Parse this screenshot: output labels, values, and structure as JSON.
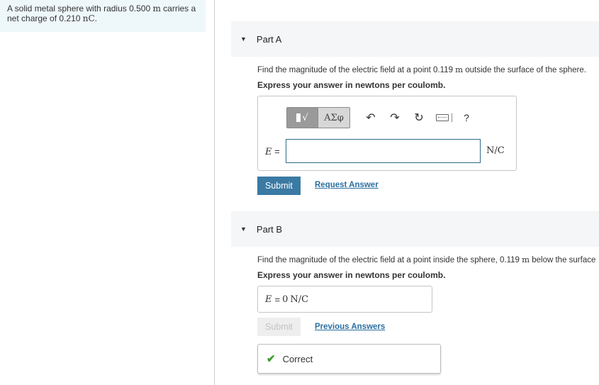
{
  "problem": {
    "text_a": "A solid metal sphere with radius 0.500 ",
    "unit_m": "m",
    "text_b": " carries a",
    "text_c": "net charge of 0.210 ",
    "unit_nC": "nC",
    "text_d": "."
  },
  "partA": {
    "title": "Part A",
    "question_a": "Find the magnitude of the electric field at a point 0.119 ",
    "question_unit": "m",
    "question_b": " outside the surface of the sphere.",
    "instruction": "Express your answer in newtons per coulomb.",
    "toolbar": {
      "templates_icon": "sqrt-template-icon",
      "greek_label": "ΑΣφ",
      "undo_icon": "↶",
      "redo_icon": "↷",
      "reset_icon": "↻",
      "keyboard_icon": "keyboard-icon",
      "help_label": "?"
    },
    "eq_var": "E",
    "eq_sign": " =",
    "input_value": "",
    "unit": "N/C",
    "submit_label": "Submit",
    "request_label": "Request Answer"
  },
  "partB": {
    "title": "Part B",
    "question_a": "Find the magnitude of the electric field at a point inside the sphere, 0.119 ",
    "question_unit": "m",
    "question_b": " below the surface",
    "instruction": "Express your answer in newtons per coulomb.",
    "eq_var": "E",
    "eq_sign": "=",
    "answer_value": "0",
    "answer_unit": "N/C",
    "submit_label": "Submit",
    "previous_label": "Previous Answers",
    "feedback": "Correct"
  },
  "colors": {
    "submit_blue": "#3a7aa3",
    "link_blue": "#2a6fa0",
    "correct_green": "#3c9a2e",
    "panel_bg": "#eef7fa"
  }
}
